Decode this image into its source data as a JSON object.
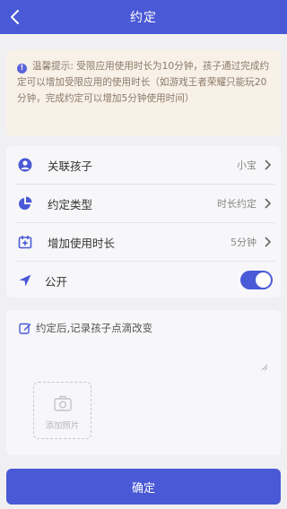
{
  "header": {
    "title": "约定"
  },
  "tip": {
    "text": "温馨提示: 受限应用使用时长为10分钟，孩子通过完成约定可以增加受限应用的使用时长（如游戏王者荣耀只能玩20分钟，完成约定可以增加5分钟使用时间）"
  },
  "settings": {
    "linked_child": {
      "label": "关联孩子",
      "value": "小宝"
    },
    "type": {
      "label": "约定类型",
      "value": "时长约定"
    },
    "add_time": {
      "label": "增加使用时长",
      "value": "5分钟"
    },
    "public": {
      "label": "公开",
      "enabled": true
    }
  },
  "note": {
    "placeholder": "约定后,记录孩子点滴改变",
    "add_photo_label": "添加照片"
  },
  "confirm": {
    "label": "确定"
  },
  "colors": {
    "primary": "#4a59d6",
    "tip_bg": "#f8f1e8",
    "tip_text": "#8a7a68"
  }
}
